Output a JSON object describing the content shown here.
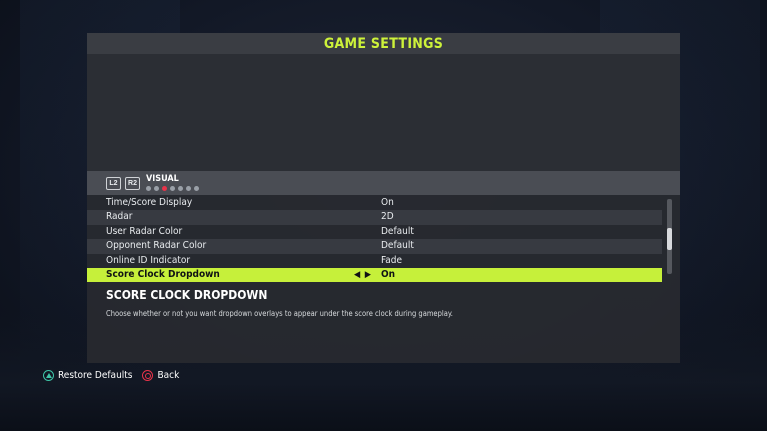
{
  "window": {
    "title": "GAME SETTINGS"
  },
  "tabs": {
    "left_button": "L2",
    "right_button": "R2",
    "current": "VISUAL",
    "page_count": 7,
    "active_page_index": 2
  },
  "settings": [
    {
      "label": "Time/Score Display",
      "value": "On"
    },
    {
      "label": "Radar",
      "value": "2D"
    },
    {
      "label": "User Radar Color",
      "value": "Default"
    },
    {
      "label": "Opponent Radar Color",
      "value": "Default"
    },
    {
      "label": "Online ID Indicator",
      "value": "Fade"
    },
    {
      "label": "Score Clock Dropdown",
      "value": "On"
    }
  ],
  "selected_arrows": "◀ ▶",
  "description": {
    "title": "SCORE CLOCK DROPDOWN",
    "text": "Choose whether or not you want dropdown overlays to appear under the score clock during gameplay."
  },
  "footer": {
    "restore_label": "Restore Defaults",
    "back_label": "Back"
  },
  "colors": {
    "accent": "#c6f03a",
    "title": "#cdf23a",
    "circle": "#e8334a",
    "triangle": "#3ec6a8"
  }
}
